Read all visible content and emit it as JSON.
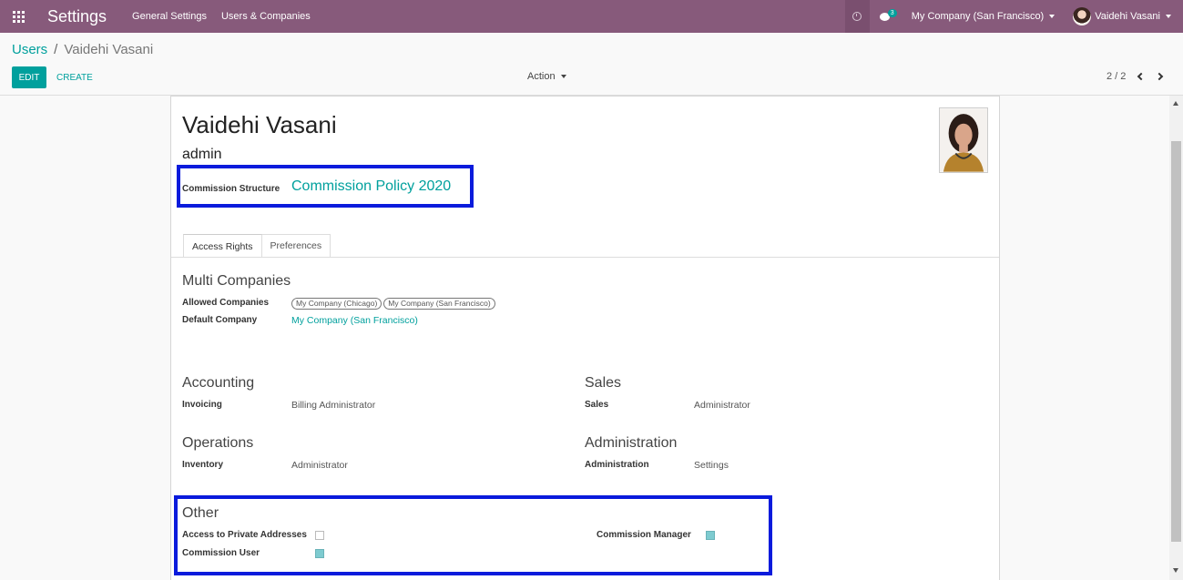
{
  "navbar": {
    "app_title": "Settings",
    "menu": [
      "General Settings",
      "Users & Companies"
    ],
    "chat_count": "3",
    "company": "My Company (San Francisco)",
    "user": "Vaidehi Vasani"
  },
  "breadcrumb": {
    "parent": "Users",
    "separator": "/",
    "current": "Vaidehi Vasani"
  },
  "toolbar": {
    "edit_label": "EDIT",
    "create_label": "CREATE",
    "action_label": "Action",
    "pager": "2 / 2"
  },
  "form": {
    "name": "Vaidehi Vasani",
    "login": "admin",
    "commission_structure_label": "Commission Structure",
    "commission_structure_value": "Commission Policy 2020",
    "tabs": [
      "Access Rights",
      "Preferences"
    ],
    "multi_companies": {
      "title": "Multi Companies",
      "allowed_label": "Allowed Companies",
      "allowed_values": [
        "My Company (Chicago)",
        "My Company (San Francisco)"
      ],
      "default_label": "Default Company",
      "default_value": "My Company (San Francisco)"
    },
    "accounting": {
      "title": "Accounting",
      "field_label": "Invoicing",
      "field_value": "Billing Administrator"
    },
    "sales": {
      "title": "Sales",
      "field_label": "Sales",
      "field_value": "Administrator"
    },
    "operations": {
      "title": "Operations",
      "field_label": "Inventory",
      "field_value": "Administrator"
    },
    "administration": {
      "title": "Administration",
      "field_label": "Administration",
      "field_value": "Settings"
    },
    "other": {
      "title": "Other",
      "private_addresses_label": "Access to Private Addresses",
      "private_addresses_checked": false,
      "commission_user_label": "Commission User",
      "commission_user_checked": true,
      "commission_manager_label": "Commission Manager",
      "commission_manager_checked": true
    }
  },
  "colors": {
    "navbar": "#875a7b",
    "accent": "#00a09d",
    "highlight": "#0a1bdc"
  }
}
